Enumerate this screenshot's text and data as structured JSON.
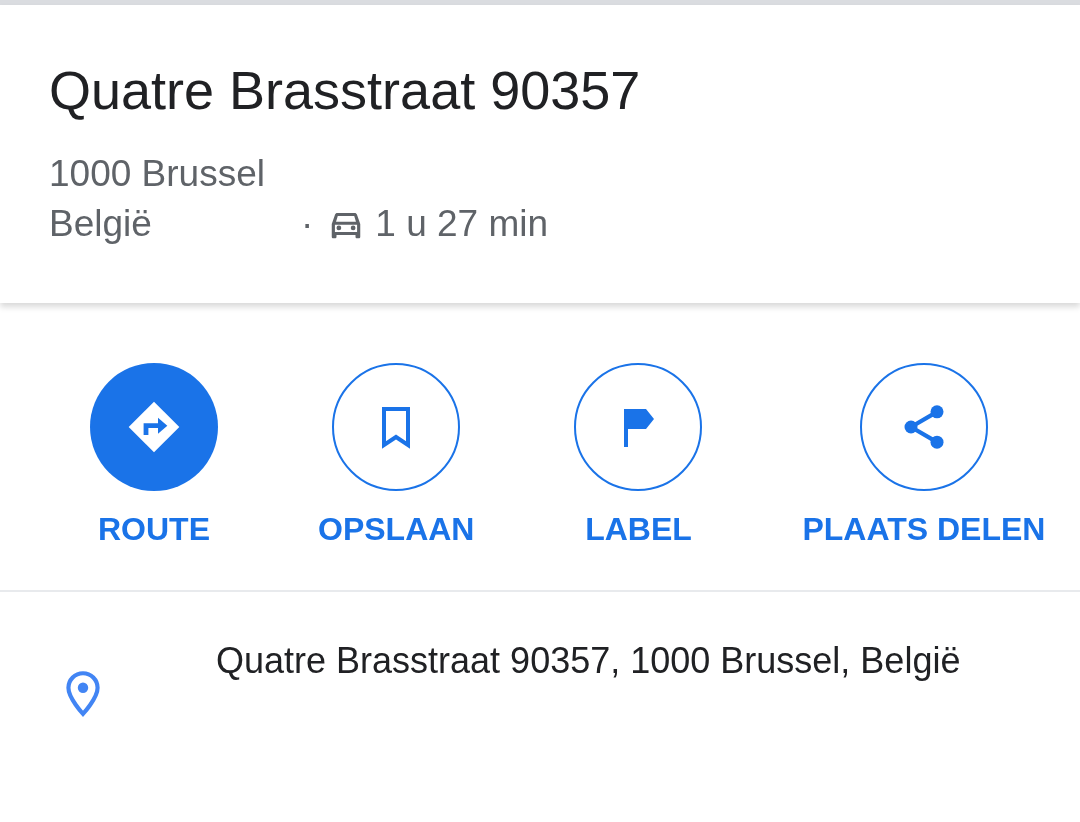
{
  "place": {
    "title": "Quatre Brasstraat 90357",
    "address_line_1": "1000 Brussel",
    "address_line_2": "België",
    "separator": "·",
    "travel_time": "1 u 27 min"
  },
  "actions": [
    {
      "label": "ROUTE",
      "kind": "filled"
    },
    {
      "label": "OPSLAAN",
      "kind": "outline"
    },
    {
      "label": "LABEL",
      "kind": "outline"
    },
    {
      "label": "PLAATS DELEN",
      "kind": "outline"
    }
  ],
  "details": {
    "address": "Quatre Brasstraat 90357, 1000 Brussel, België"
  }
}
